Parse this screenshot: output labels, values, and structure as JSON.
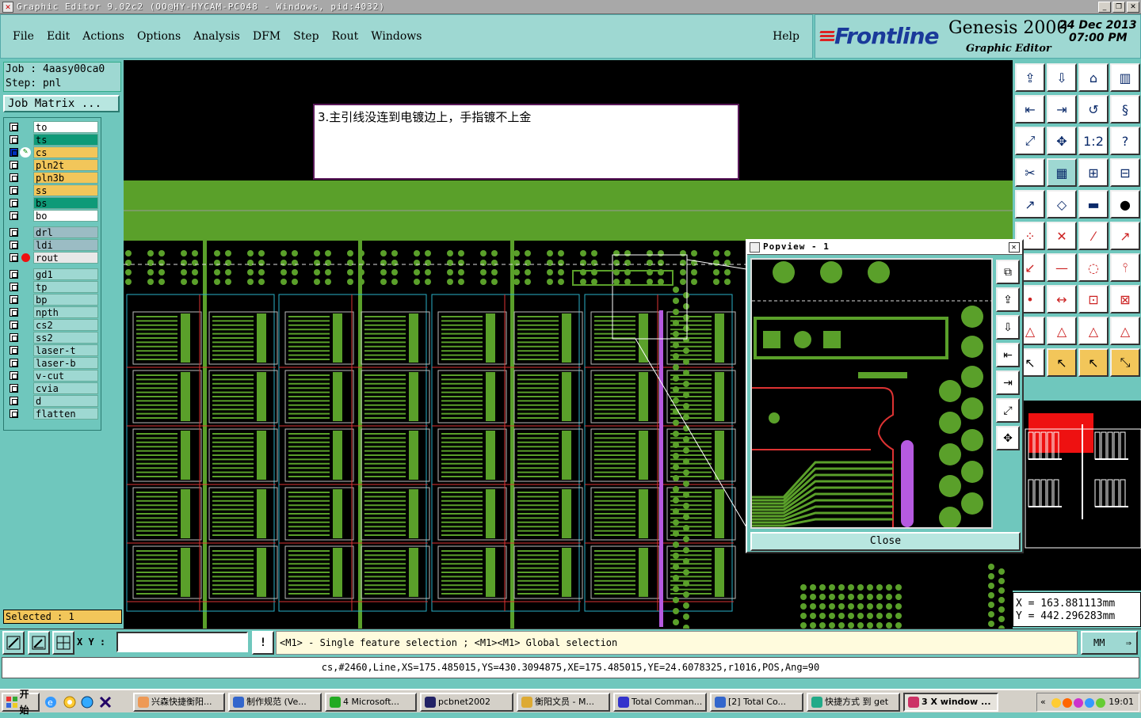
{
  "window": {
    "title": "Graphic Editor 9.02c2 (OO@HY-HYCAM-PC048 - Windows, pid:4032)",
    "minimize": "_",
    "restore": "❐",
    "close": "✕"
  },
  "menu": {
    "items": [
      "File",
      "Edit",
      "Actions",
      "Options",
      "Analysis",
      "DFM",
      "Step",
      "Rout",
      "Windows"
    ],
    "help": "Help"
  },
  "brand": {
    "logo": "Frontline",
    "product": "Genesis 2000",
    "subtitle": "Graphic Editor",
    "date": "24 Dec 2013",
    "time": "07:00 PM"
  },
  "job": {
    "job_line": "Job : 4aasy00ca0",
    "step_line": "Step: pnl",
    "matrix_button": "Job Matrix ..."
  },
  "layers": [
    {
      "name": "to",
      "color": "#ffffff"
    },
    {
      "name": "ts",
      "color": "#0e9a78"
    },
    {
      "name": "cs",
      "color": "#f2c65a",
      "selected": true
    },
    {
      "name": "pln2t",
      "color": "#f2c65a"
    },
    {
      "name": "pln3b",
      "color": "#f2c65a"
    },
    {
      "name": "ss",
      "color": "#f2c65a"
    },
    {
      "name": "bs",
      "color": "#0e9a78"
    },
    {
      "name": "bo",
      "color": "#ffffff"
    },
    {
      "name": "drl",
      "color": "#9bbcc4"
    },
    {
      "name": "ldi",
      "color": "#9bbcc4"
    },
    {
      "name": "rout",
      "color": "#e8e8e8",
      "marker": true
    },
    {
      "name": "gd1",
      "color": "#9ed8d2"
    },
    {
      "name": "tp",
      "color": "#9ed8d2"
    },
    {
      "name": "bp",
      "color": "#9ed8d2"
    },
    {
      "name": "npth",
      "color": "#9ed8d2"
    },
    {
      "name": "cs2",
      "color": "#9ed8d2"
    },
    {
      "name": "ss2",
      "color": "#9ed8d2"
    },
    {
      "name": "laser-t",
      "color": "#9ed8d2"
    },
    {
      "name": "laser-b",
      "color": "#9ed8d2"
    },
    {
      "name": "v-cut",
      "color": "#9ed8d2"
    },
    {
      "name": "cvia",
      "color": "#9ed8d2"
    },
    {
      "name": "d",
      "color": "#9ed8d2"
    },
    {
      "name": "flatten",
      "color": "#9ed8d2"
    }
  ],
  "selected_count": "Selected : 1",
  "annotation": "3.主引线没连到电镀边上，手指镀不上金",
  "popview": {
    "title": "Popview - 1",
    "close_label": "Close",
    "close_x": "✕"
  },
  "coords": {
    "x": "X  =  163.881113mm",
    "y": "Y  =  442.296283mm"
  },
  "command": {
    "xy_label": "X Y :",
    "input_value": "",
    "info_icon": "!",
    "hint": "<M1> - Single feature selection ; <M1><M1> Global selection",
    "units": "MM"
  },
  "status_line": "cs,#2460,Line,XS=175.485015,YS=430.3094875,XE=175.485015,YE=24.6078325,r1016,POS,Ang=90",
  "taskbar": {
    "start": "开始",
    "tasks": [
      "兴森快捷衡阳...",
      "制作规范 (Ve...",
      "4 Microsoft...",
      "pcbnet2002",
      "衡阳文员 - M...",
      "Total Comman...",
      "[2] Total Co...",
      "快捷方式 到 get",
      "3 X window ..."
    ],
    "tray_chevron": "«",
    "clock": "19:01"
  },
  "colors": {
    "panel": "#6fc7bd",
    "light_panel": "#9ed8d2",
    "copper": "#5aa02a",
    "highlight": "#f2c65a"
  }
}
